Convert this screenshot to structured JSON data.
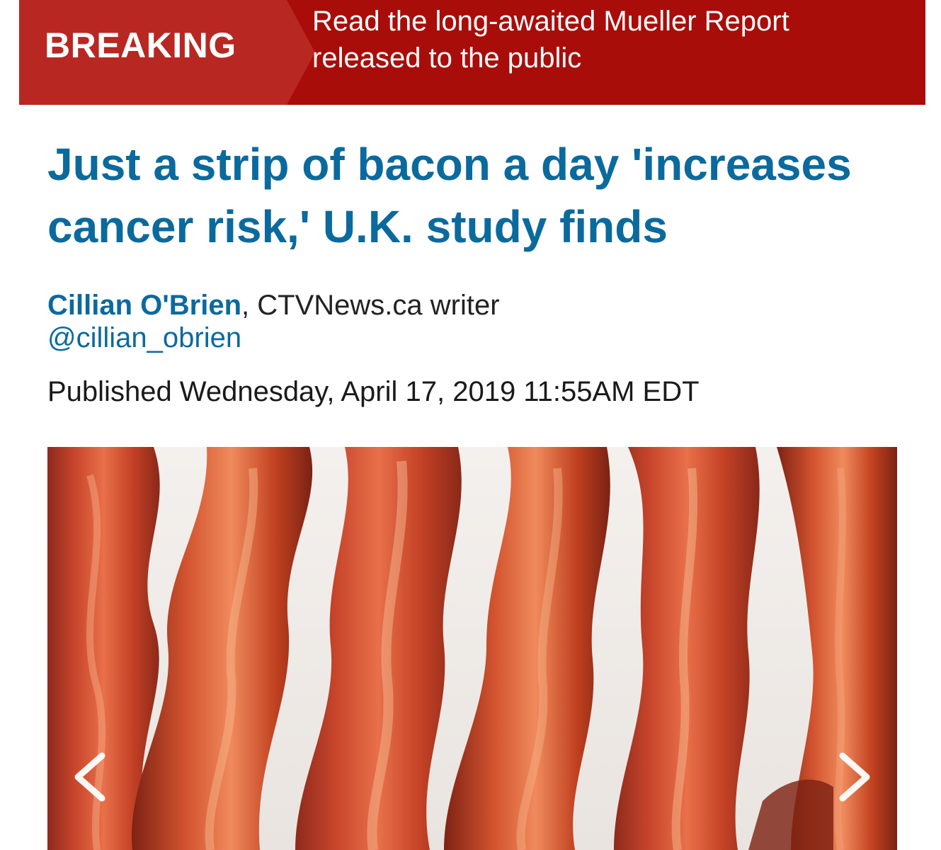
{
  "breaking": {
    "label": "BREAKING",
    "text": "Read the long-awaited Mueller Report released to the public"
  },
  "article": {
    "headline": "Just a strip of bacon a day 'increases cancer risk,' U.K. study finds",
    "author_name": "Cillian O'Brien",
    "author_role": ", CTVNews.ca writer",
    "twitter_handle": "@cillian_obrien",
    "published": "Published Wednesday, April 17, 2019 11:55AM EDT"
  },
  "gallery": {
    "image_subject": "strips of cooked bacon",
    "prev_icon": "chevron-left-icon",
    "next_icon": "chevron-right-icon"
  },
  "colors": {
    "breaking_bg": "#a80d0a",
    "breaking_tag_bg": "#b82722",
    "headline_blue": "#0b6a9d",
    "text": "#1a1a1a"
  }
}
